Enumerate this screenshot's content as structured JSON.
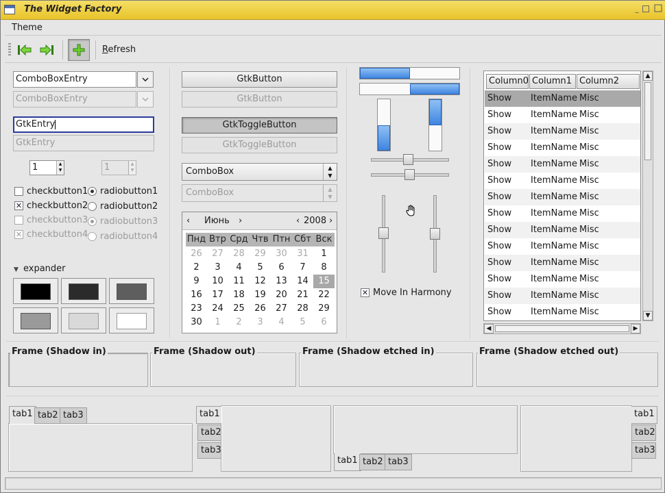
{
  "window": {
    "title": "The Widget Factory"
  },
  "menu": {
    "theme": "Theme"
  },
  "toolbar": {
    "refresh_label": "Refresh",
    "refresh_underline": "R",
    "refresh_rest": "efresh"
  },
  "entries": {
    "combo_entry": "ComboBoxEntry",
    "combo_entry_disabled": "ComboBoxEntry",
    "gtk_entry": "GtkEntry",
    "gtk_entry_disabled": "GtkEntry",
    "spin_value": "1",
    "spin_value_disabled": "1"
  },
  "checks": [
    {
      "label": "checkbutton1",
      "checked": false,
      "disabled": false
    },
    {
      "label": "checkbutton2",
      "checked": true,
      "disabled": false
    },
    {
      "label": "checkbutton3",
      "checked": false,
      "disabled": true
    },
    {
      "label": "checkbutton4",
      "checked": true,
      "disabled": true
    }
  ],
  "radios": [
    {
      "label": "radiobutton1",
      "selected": true,
      "disabled": false
    },
    {
      "label": "radiobutton2",
      "selected": false,
      "disabled": false
    },
    {
      "label": "radiobutton3",
      "selected": true,
      "disabled": true
    },
    {
      "label": "radiobutton4",
      "selected": false,
      "disabled": true
    }
  ],
  "expander": {
    "label": "expander"
  },
  "swatches": [
    "#000000",
    "#2b2b2b",
    "#5e5e5e",
    "#9a9a9a",
    "#d9d9d9",
    "#ffffff"
  ],
  "buttons": {
    "gtk_button": "GtkButton",
    "gtk_button_disabled": "GtkButton",
    "toggle": "GtkToggleButton",
    "toggle_disabled": "GtkToggleButton",
    "combobox": "ComboBox",
    "combobox_disabled": "ComboBox"
  },
  "calendar": {
    "month": "Июнь",
    "year": "2008",
    "days_of_week": [
      "Пнд",
      "Втр",
      "Срд",
      "Чтв",
      "Птн",
      "Сбт",
      "Вск"
    ],
    "weeks": [
      [
        "26",
        "27",
        "28",
        "29",
        "30",
        "31",
        "1"
      ],
      [
        "2",
        "3",
        "4",
        "5",
        "6",
        "7",
        "8"
      ],
      [
        "9",
        "10",
        "11",
        "12",
        "13",
        "14",
        "15"
      ],
      [
        "16",
        "17",
        "18",
        "19",
        "20",
        "21",
        "22"
      ],
      [
        "23",
        "24",
        "25",
        "26",
        "27",
        "28",
        "29"
      ],
      [
        "30",
        "1",
        "2",
        "3",
        "4",
        "5",
        "6"
      ]
    ],
    "selected_day": "15"
  },
  "progress": {
    "horizontal_1": 0.5,
    "horizontal_2": 0.5,
    "vertical_1": 0.5,
    "vertical_2": 0.5
  },
  "scales": {
    "h1": 0.5,
    "h2": 0.5,
    "v1": 0.5,
    "v2": 0.5
  },
  "harmony": {
    "label": "Move In Harmony",
    "checked": true
  },
  "tree": {
    "columns": [
      "Column0",
      "Column1",
      "Column2"
    ],
    "rows": [
      [
        "Show",
        "ItemName",
        "Misc"
      ],
      [
        "Show",
        "ItemName",
        "Misc"
      ],
      [
        "Show",
        "ItemName",
        "Misc"
      ],
      [
        "Show",
        "ItemName",
        "Misc"
      ],
      [
        "Show",
        "ItemName",
        "Misc"
      ],
      [
        "Show",
        "ItemName",
        "Misc"
      ],
      [
        "Show",
        "ItemName",
        "Misc"
      ],
      [
        "Show",
        "ItemName",
        "Misc"
      ],
      [
        "Show",
        "ItemName",
        "Misc"
      ],
      [
        "Show",
        "ItemName",
        "Misc"
      ],
      [
        "Show",
        "ItemName",
        "Misc"
      ],
      [
        "Show",
        "ItemName",
        "Misc"
      ],
      [
        "Show",
        "ItemName",
        "Misc"
      ],
      [
        "Show",
        "ItemName",
        "Misc"
      ]
    ]
  },
  "frames": {
    "shadow_in": "Frame (Shadow in)",
    "shadow_out": "Frame (Shadow out)",
    "etched_in": "Frame (Shadow etched in)",
    "etched_out": "Frame (Shadow etched out)"
  },
  "tabs": {
    "t1": "tab1",
    "t2": "tab2",
    "t3": "tab3"
  },
  "colors": {
    "accent": "#3f85e0",
    "titlebar": "#e9c42a",
    "focus": "#2a3c9a"
  }
}
